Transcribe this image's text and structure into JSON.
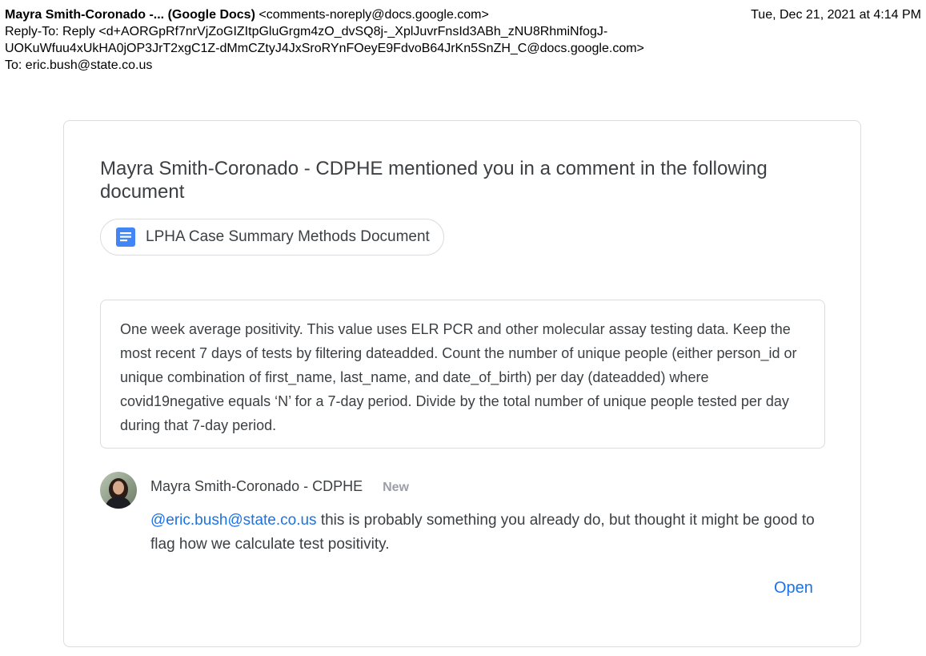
{
  "email": {
    "from_name": "Mayra Smith-Coronado -... (Google Docs)",
    "from_address": "<comments-noreply@docs.google.com>",
    "date": "Tue, Dec 21, 2021 at 4:14 PM",
    "reply_to_label": "Reply-To:",
    "reply_to_line1": "Reply <d+AORGpRf7nrVjZoGIZItpGluGrgm4zO_dvSQ8j-_XplJuvrFnsId3ABh_zNU8RhmiNfogJ-",
    "reply_to_line2": "UOKuWfuu4xUkHA0jOP3JrT2xgC1Z-dMmCZtyJ4JxSroRYnFOeyE9FdvoB64JrKn5SnZH_C@docs.google.com>",
    "to_label": "To:",
    "to_address": "eric.bush@state.co.us"
  },
  "card": {
    "title": "Mayra Smith-Coronado - CDPHE mentioned you in a comment in the following document",
    "document_name": "LPHA Case Summary Methods Document",
    "document_icon": "google-docs-icon",
    "quoted_text": "One week average positivity. This value uses ELR PCR and other molecular assay testing data. Keep the most recent 7 days of tests by filtering dateadded. Count the number of unique people (either person_id or unique combination of first_name, last_name, and date_of_birth) per day (dateadded) where covid19negative equals ‘N’ for a 7-day period. Divide by the total number of unique people tested per day during that 7-day period.",
    "commenter_name": "Mayra Smith-Coronado - CDPHE",
    "new_badge": "New",
    "mention": "@eric.bush@state.co.us",
    "comment_rest": " this is probably something you already do, but thought it might be good to flag how we calculate test positivity.",
    "open_label": "Open"
  },
  "colors": {
    "link_blue": "#1a73e8",
    "docs_blue": "#4285f4",
    "text_gray": "#3c4043",
    "border_gray": "#dadce0",
    "badge_gray": "#9aa0a6"
  }
}
